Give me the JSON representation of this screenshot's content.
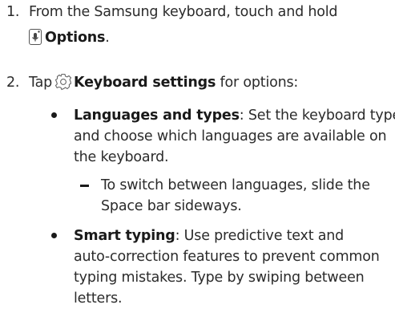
{
  "steps": [
    {
      "number": "1.",
      "line1": "From the Samsung keyboard, touch and hold",
      "icon": "mic-key-icon",
      "bold": "Options",
      "after": "."
    },
    {
      "number": "2.",
      "before": "Tap",
      "icon": "gear-icon",
      "bold": "Keyboard settings",
      "after": " for options:"
    }
  ],
  "options": [
    {
      "title": "Languages and types",
      "lines": [
        ": Set the keyboard type",
        "and choose which languages are available on",
        "the keyboard."
      ],
      "sub": [
        "To switch between languages, slide the",
        "Space bar sideways."
      ]
    },
    {
      "title": "Smart typing",
      "lines": [
        ": Use predictive text and",
        "auto-correction features to prevent common",
        "typing mistakes. Type by swiping between",
        "letters."
      ]
    }
  ]
}
